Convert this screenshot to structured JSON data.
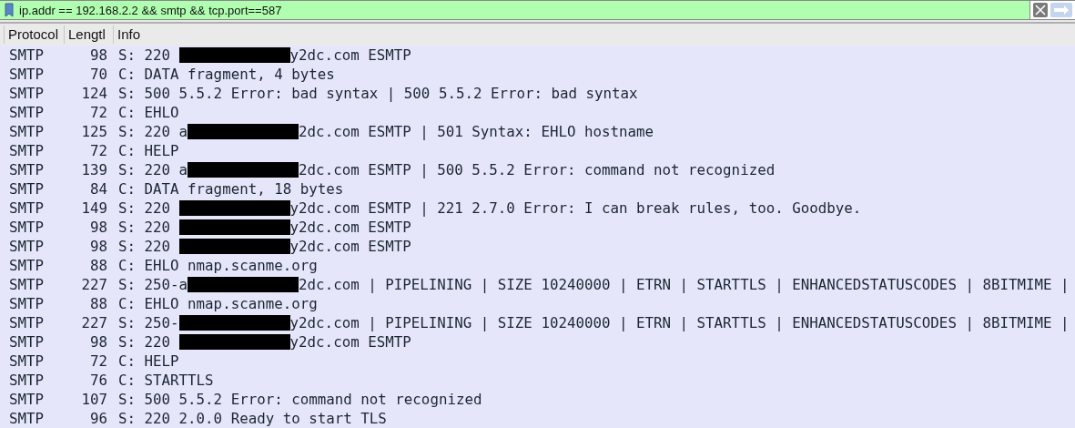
{
  "filter": {
    "value": "ip.addr == 192.168.2.2 && smtp && tcp.port==587"
  },
  "columns": [
    "Protocol",
    "Lengtl",
    "Info"
  ],
  "rows": [
    {
      "protocol": "SMTP",
      "length": "98",
      "kind": "redacted",
      "before": "S: 220 ",
      "after": "y2dc.com ESMTP"
    },
    {
      "protocol": "SMTP",
      "length": "70",
      "kind": "plain",
      "info": "C: DATA fragment, 4 bytes"
    },
    {
      "protocol": "SMTP",
      "length": "124",
      "kind": "plain",
      "info": "S: 500 5.5.2 Error: bad syntax | 500 5.5.2 Error: bad syntax"
    },
    {
      "protocol": "SMTP",
      "length": "72",
      "kind": "plain",
      "info": "C: EHLO"
    },
    {
      "protocol": "SMTP",
      "length": "125",
      "kind": "redacted",
      "before": "S: 220 a",
      "after": "2dc.com ESMTP | 501 Syntax: EHLO hostname"
    },
    {
      "protocol": "SMTP",
      "length": "72",
      "kind": "plain",
      "info": "C: HELP"
    },
    {
      "protocol": "SMTP",
      "length": "139",
      "kind": "redacted",
      "before": "S: 220 a",
      "after": "2dc.com ESMTP | 500 5.5.2 Error: command not recognized"
    },
    {
      "protocol": "SMTP",
      "length": "84",
      "kind": "plain",
      "info": "C: DATA fragment, 18 bytes"
    },
    {
      "protocol": "SMTP",
      "length": "149",
      "kind": "redacted",
      "before": "S: 220 ",
      "after": "y2dc.com ESMTP | 221 2.7.0 Error: I can break rules, too. Goodbye."
    },
    {
      "protocol": "SMTP",
      "length": "98",
      "kind": "redacted",
      "before": "S: 220 ",
      "after": "y2dc.com ESMTP"
    },
    {
      "protocol": "SMTP",
      "length": "98",
      "kind": "redacted",
      "before": "S: 220 ",
      "after": "y2dc.com ESMTP"
    },
    {
      "protocol": "SMTP",
      "length": "88",
      "kind": "plain",
      "info": "C: EHLO nmap.scanme.org"
    },
    {
      "protocol": "SMTP",
      "length": "227",
      "kind": "redacted",
      "before": "S: 250-a",
      "after": "2dc.com | PIPELINING | SIZE 10240000 | ETRN | STARTTLS | ENHANCEDSTATUSCODES | 8BITMIME |"
    },
    {
      "protocol": "SMTP",
      "length": "88",
      "kind": "plain",
      "info": "C: EHLO nmap.scanme.org"
    },
    {
      "protocol": "SMTP",
      "length": "227",
      "kind": "redacted",
      "before": "S: 250-",
      "after": "y2dc.com | PIPELINING | SIZE 10240000 | ETRN | STARTTLS | ENHANCEDSTATUSCODES | 8BITMIME |"
    },
    {
      "protocol": "SMTP",
      "length": "98",
      "kind": "redacted",
      "before": "S: 220 ",
      "after": "y2dc.com ESMTP"
    },
    {
      "protocol": "SMTP",
      "length": "72",
      "kind": "plain",
      "info": "C: HELP"
    },
    {
      "protocol": "SMTP",
      "length": "76",
      "kind": "plain",
      "info": "C: STARTTLS"
    },
    {
      "protocol": "SMTP",
      "length": "107",
      "kind": "plain",
      "info": "S: 500 5.5.2 Error: command not recognized"
    },
    {
      "protocol": "SMTP",
      "length": "96",
      "kind": "plain",
      "info": "S: 220 2.0.0 Ready to start TLS"
    }
  ]
}
